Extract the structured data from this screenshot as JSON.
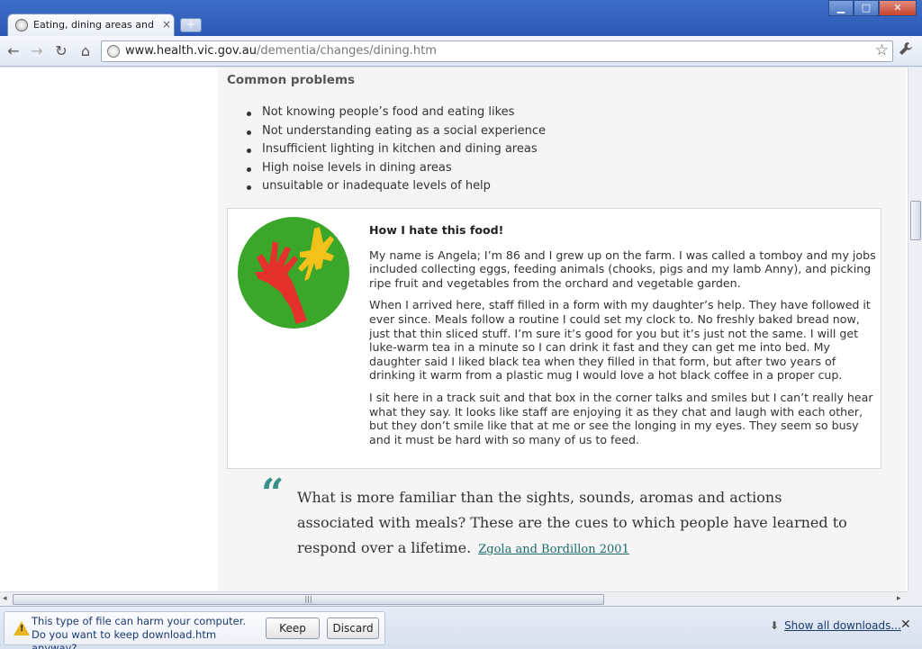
{
  "browser": {
    "tab_title": "Eating, dining areas and kitc",
    "tab_close": "×",
    "new_tab": "+",
    "window_buttons": {
      "minimize": "▁",
      "maximize": "□",
      "close": "✕"
    },
    "nav": {
      "back": "←",
      "forward": "→",
      "reload": "↻",
      "home": "⌂"
    },
    "url_host": "www.health.vic.gov.au",
    "url_path": "/dementia/changes/dining.htm",
    "star": "☆",
    "wrench": "🔧"
  },
  "page": {
    "section_heading": "Common problems",
    "problems": [
      "Not knowing people’s food and eating likes",
      "Not understanding eating as a social experience",
      "Insufficient lighting in kitchen and dining areas",
      "High noise levels in dining areas",
      "unsuitable or inadequate levels of help"
    ],
    "story": {
      "title": "How I hate this food!",
      "paragraphs": [
        "My name is Angela; I’m 86 and I grew up on the farm. I was called a tomboy and my jobs included collecting eggs, feeding animals (chooks, pigs and my lamb Anny), and picking ripe fruit and vegetables from the orchard and vegetable garden.",
        "When I arrived here, staff filled in a form with my daughter’s help. They have followed it ever since. Meals follow a routine I could set my clock to. No freshly baked bread now, just that thin sliced stuff. I’m sure it’s good for you but it’s just not the same. I will get luke-warm tea in a minute so I can drink it fast and they can get me into bed. My daughter said I liked black tea when they filled in that form, but after two years of drinking it warm from a plastic mug I would love a hot black coffee in a proper cup.",
        "I sit here in a track suit and that box in the corner talks and smiles but I can’t really hear what they say. It looks like staff are enjoying it as they chat and laugh with each other, but they don’t smile like that at me or see the longing in my eyes. They seem so busy and it must be hard with so many of us to feed."
      ]
    },
    "quote": {
      "mark": "“",
      "text": "What is more familiar than the sights, sounds, aromas and actions associated with meals? These are the cues to which people have learned to respond over a lifetime.",
      "citation": "Zgola and Bordillon 2001"
    }
  },
  "scrollbar": {
    "grip": "|||",
    "left_arrow": "◂",
    "right_arrow": "▸"
  },
  "download_bar": {
    "message": "This type of file can harm your computer. Do you want to keep download.htm anyway?",
    "keep_label": "Keep",
    "discard_label": "Discard",
    "show_all_label": "Show all downloads...",
    "download_arrow": "⬇",
    "close": "✕"
  },
  "colors": {
    "quote_accent": "#3a8f8a",
    "image_circle": "#3aa72a",
    "hand_red": "#e5312b",
    "hand_yellow": "#f2c21b"
  }
}
